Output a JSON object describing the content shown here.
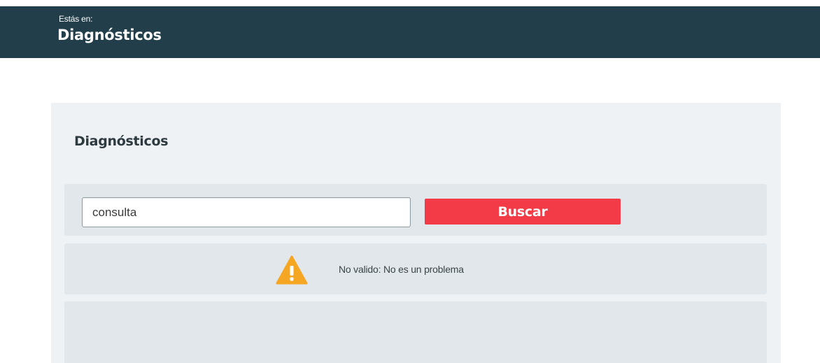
{
  "header": {
    "location_label": "Estás en:",
    "location_title": "Diagnósticos"
  },
  "panel": {
    "title": "Diagnósticos",
    "search": {
      "value": "consulta",
      "button_label": "Buscar"
    },
    "alert": {
      "icon": "warning-icon",
      "message": "No valido: No es un problema"
    }
  },
  "colors": {
    "header_bg": "#213e4a",
    "button_bg": "#f23b47",
    "warning": "#f5a623"
  }
}
